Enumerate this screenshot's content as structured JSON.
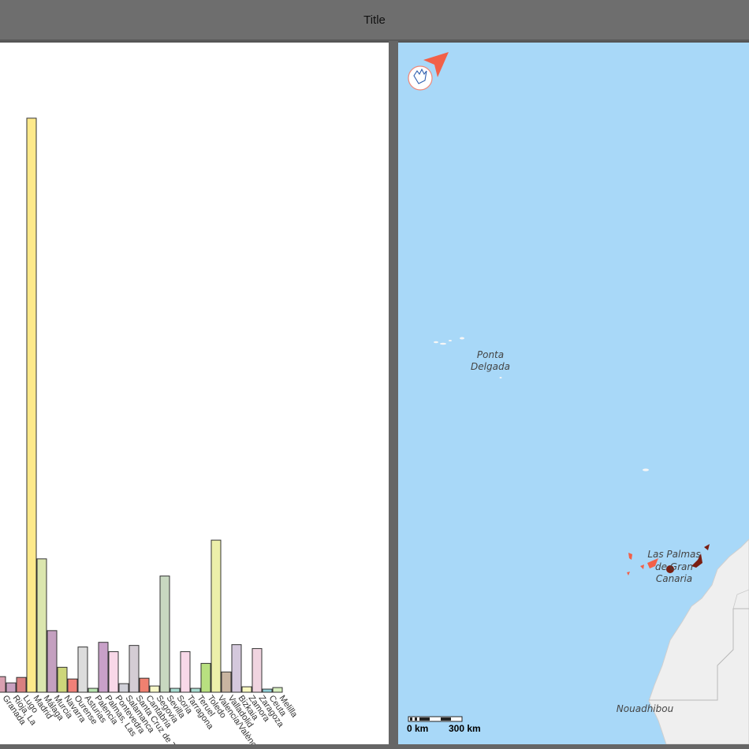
{
  "window": {
    "title": "Title"
  },
  "chart_data": {
    "type": "bar",
    "categories": [
      "Granada",
      "Rioja, La",
      "Lugo",
      "Madrid",
      "Málaga",
      "Murcia",
      "Navarra",
      "Ourense",
      "Asturias",
      "Palencia",
      "Palmas, Las",
      "Pontevedra",
      "Salamanca",
      "Santa Cruz de Tenerife",
      "Cantabria",
      "Segovia",
      "Sevilla",
      "Soria",
      "Tarragona",
      "Teruel",
      "Toledo",
      "Valencia/València",
      "Valladolid",
      "Bizkaia",
      "Zamora",
      "Zaragoza",
      "Ceuta",
      "Melilla"
    ],
    "values": [
      20,
      12,
      19,
      736,
      171,
      79,
      32,
      17,
      58,
      5,
      64,
      52,
      11,
      60,
      18,
      8,
      149,
      5,
      52,
      5,
      37,
      195,
      26,
      61,
      7,
      56,
      4,
      6
    ],
    "colors": [
      "#d9a0b0",
      "#c8a0c0",
      "#d98080",
      "#fde98a",
      "#dbe6ae",
      "#c4a0c0",
      "#cdd67a",
      "#f08078",
      "#dcdcdc",
      "#b8e4b0",
      "#c8a0c8",
      "#f8d8e8",
      "#d0d0d8",
      "#d4ccd4",
      "#f08070",
      "#f8f8c8",
      "#c8d8c0",
      "#a8dcd0",
      "#f8d8e8",
      "#a8dcd0",
      "#b8e080",
      "#ecefaa",
      "#c8b4a0",
      "#d4c8dc",
      "#f8f8c0",
      "#f0d4e0",
      "#90d0d8",
      "#d8f0c0"
    ],
    "title": "",
    "xlabel": "",
    "ylabel": "",
    "ylim": [
      0,
      745
    ]
  },
  "map": {
    "labels": {
      "ponta_delgada_1": "Ponta",
      "ponta_delgada_2": "Delgada",
      "las_palmas_1": "Las Palmas",
      "las_palmas_2": "de Gran",
      "las_palmas_3": "Canaria",
      "nouadhibou": "Nouadhibou"
    },
    "scale": {
      "left": "0 km",
      "right": "300 km"
    },
    "colors": {
      "sea": "#a8d8f8",
      "land": "#efefef",
      "marker": "#f26048",
      "island": "#7a1e12"
    }
  },
  "widget": {
    "icon": "hand-pointing-icon"
  }
}
